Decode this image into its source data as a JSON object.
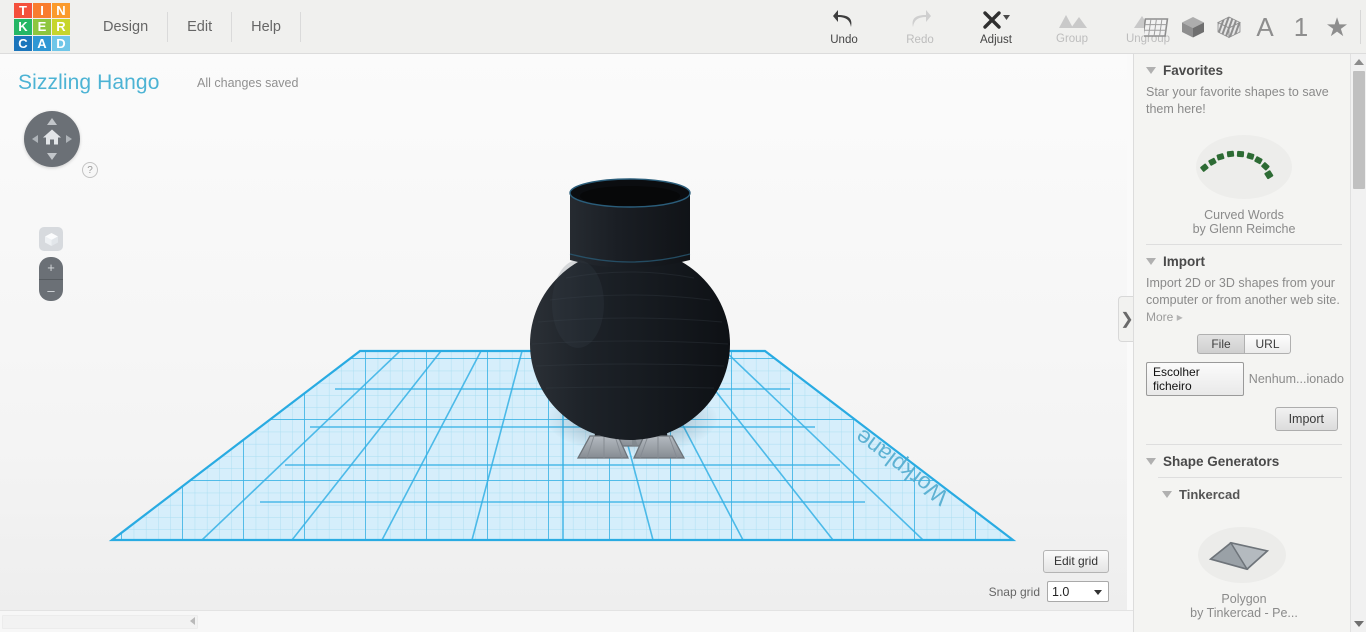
{
  "app": {
    "logo_letters": [
      {
        "ch": "T",
        "color": "#f4503c"
      },
      {
        "ch": "I",
        "color": "#f97c2e"
      },
      {
        "ch": "N",
        "color": "#fb9a2b"
      },
      {
        "ch": "K",
        "color": "#25b765"
      },
      {
        "ch": "E",
        "color": "#8dc63f"
      },
      {
        "ch": "R",
        "color": "#c7d52c"
      },
      {
        "ch": "C",
        "color": "#1b75bb"
      },
      {
        "ch": "A",
        "color": "#2e97d4"
      },
      {
        "ch": "D",
        "color": "#6fc6e8"
      }
    ]
  },
  "menu": {
    "items": [
      {
        "label": "Design"
      },
      {
        "label": "Edit"
      },
      {
        "label": "Help"
      }
    ]
  },
  "toolbar": {
    "tools": [
      {
        "label": "Undo",
        "icon": "undo-icon",
        "enabled": true
      },
      {
        "label": "Redo",
        "icon": "redo-icon",
        "enabled": false
      },
      {
        "label": "Adjust",
        "icon": "adjust-icon",
        "enabled": true
      },
      {
        "label": "Group",
        "icon": "group-icon",
        "enabled": false
      },
      {
        "label": "Ungroup",
        "icon": "ungroup-icon",
        "enabled": false
      }
    ],
    "right_icons": [
      {
        "name": "workplane-icon",
        "glyph": "▦"
      },
      {
        "name": "solid-cube-icon",
        "glyph": "⬛"
      },
      {
        "name": "striped-cube-icon",
        "glyph": "▨"
      },
      {
        "name": "text-icon",
        "glyph": "A"
      },
      {
        "name": "number-icon",
        "glyph": "1"
      },
      {
        "name": "favorites-star-icon",
        "glyph": "★"
      }
    ]
  },
  "editor": {
    "design_name": "Sizzling Hango",
    "save_status": "All changes saved",
    "help_badge": "?",
    "nav_home_icon": "home-icon",
    "view_cube_icon": "view-cube-icon",
    "zoom_in": "+",
    "zoom_out": "–",
    "workplane_label": "Workplane",
    "edit_grid_label": "Edit grid",
    "snap_grid_label": "Snap grid",
    "snap_grid_value": "1.0"
  },
  "panel": {
    "sections": [
      {
        "id": "favorites",
        "title": "Favorites",
        "description": "Star your favorite shapes to save them here!",
        "item_name": "Curved Words",
        "item_by": "by Glenn Reimche"
      },
      {
        "id": "import",
        "title": "Import",
        "description": "Import 2D or 3D shapes from your computer or from another web site.",
        "more_label": "More",
        "more_arrow": "▸",
        "tab_file": "File",
        "tab_url": "URL",
        "file_button": "Escolher ficheiro",
        "file_status": "Nenhum...ionado",
        "import_button": "Import"
      },
      {
        "id": "shape-generators",
        "title": "Shape Generators",
        "sub_title": "Tinkercad",
        "item_name": "Polygon",
        "item_by": "by Tinkercad - Pe..."
      }
    ],
    "collapse_handle": "❯"
  },
  "colors": {
    "accent_title": "#4cb3d4",
    "grid_line": "#29abe2",
    "grid_fill": "#bfe8f7",
    "model_black": "#1a1d22",
    "model_foot": "#9aa0a6"
  }
}
